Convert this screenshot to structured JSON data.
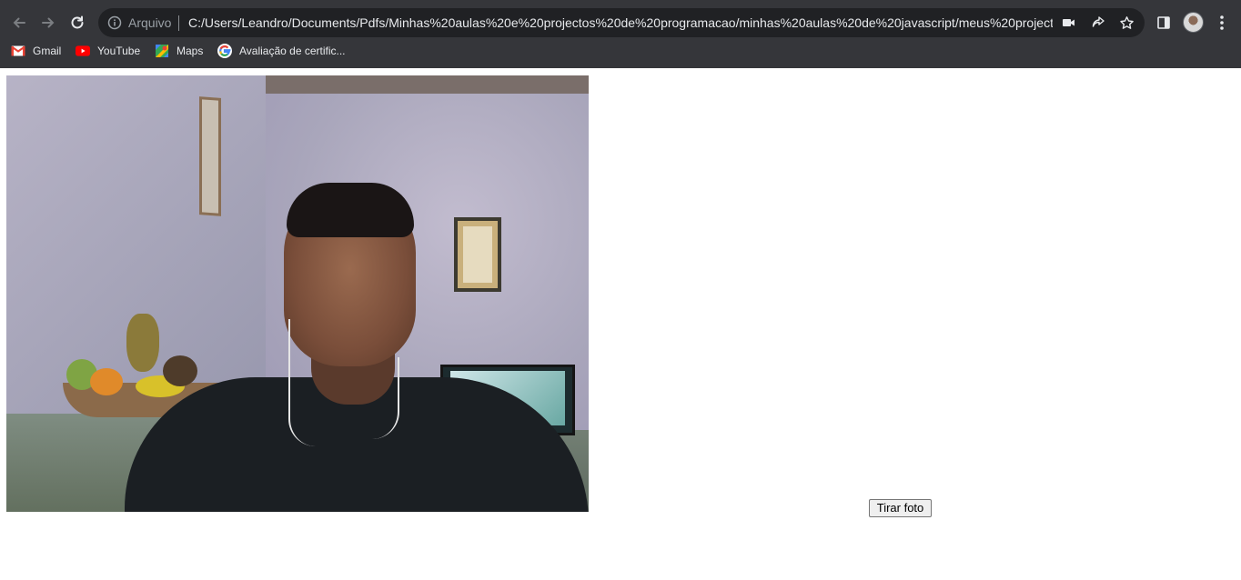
{
  "browser": {
    "omnibox": {
      "scheme_label": "Arquivo",
      "url": "C:/Users/Leandro/Documents/Pdfs/Minhas%20aulas%20e%20projectos%20de%20programacao/minhas%20aulas%20de%20javascript/meus%20project..."
    },
    "bookmarks": [
      {
        "label": "Gmail",
        "icon": "gmail-icon"
      },
      {
        "label": "YouTube",
        "icon": "youtube-icon"
      },
      {
        "label": "Maps",
        "icon": "maps-icon"
      },
      {
        "label": "Avaliação de certific...",
        "icon": "google-icon"
      }
    ],
    "colors": {
      "chrome_bg": "#35363a",
      "omnibox_bg": "#202124",
      "text": "#e8eaed",
      "muted": "#9aa0a6"
    }
  },
  "page": {
    "video_feed": "webcam-video",
    "capture_button_label": "Tirar foto"
  }
}
